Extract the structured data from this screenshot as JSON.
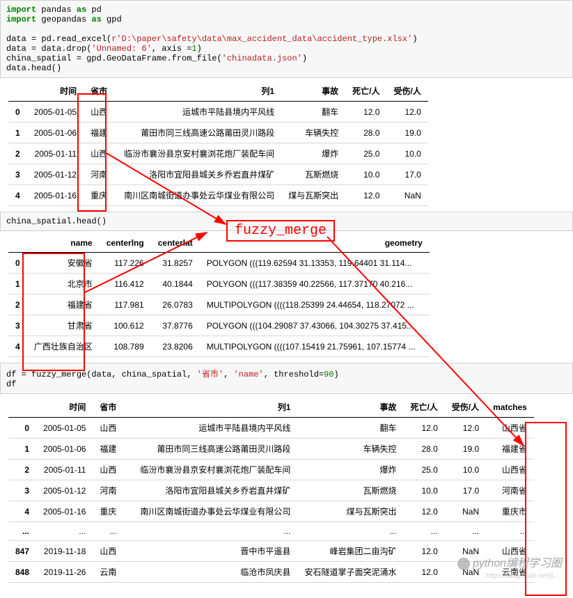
{
  "code1": {
    "l1a": "import",
    "l1b": " pandas ",
    "l1c": "as",
    "l1d": " pd",
    "l2a": "import",
    "l2b": " geopandas ",
    "l2c": "as",
    "l2d": " gpd",
    "l3": "",
    "l4a": "data = pd.read_excel(",
    "l4b": "r'D:\\paper\\safety\\data\\max_accident_data\\accident_type.xlsx'",
    "l4c": ")",
    "l5a": "data = data.drop(",
    "l5b": "'Unnamed: 6'",
    "l5c": ", axis =",
    "l5d": "1",
    "l5e": ")",
    "l6a": "china_spatial = gpd.GeoDataFrame.from_file(",
    "l6b": "'chinadata.json'",
    "l6c": ")",
    "l7": "data.head()"
  },
  "table1": {
    "headers": [
      "",
      "时间",
      "省市",
      "列1",
      "事故",
      "死亡/人",
      "受伤/人"
    ],
    "rows": [
      [
        "0",
        "2005-01-05",
        "山西",
        "运城市平陆县境内平风线",
        "翻车",
        "12.0",
        "12.0"
      ],
      [
        "1",
        "2005-01-06",
        "福建",
        "莆田市同三线高速公路莆田灵川路段",
        "车辆失控",
        "28.0",
        "19.0"
      ],
      [
        "2",
        "2005-01-11",
        "山西",
        "临汾市襄汾县京安村襄浏花炮厂装配车间",
        "爆炸",
        "25.0",
        "10.0"
      ],
      [
        "3",
        "2005-01-12",
        "河南",
        "洛阳市宜阳县城关乡乔岩直井煤矿",
        "瓦斯燃烧",
        "10.0",
        "17.0"
      ],
      [
        "4",
        "2005-01-16",
        "重庆",
        "南川区南城街道办事处云华煤业有限公司",
        "煤与瓦斯突出",
        "12.0",
        "NaN"
      ]
    ]
  },
  "code2": "china_spatial.head()",
  "table2": {
    "headers": [
      "",
      "name",
      "centerlng",
      "centerlat",
      "geometry"
    ],
    "rows": [
      [
        "0",
        "安徽省",
        "117.226",
        "31.8257",
        "POLYGON (((119.62594 31.13353, 119.64401 31.114..."
      ],
      [
        "1",
        "北京市",
        "116.412",
        "40.1844",
        "POLYGON (((117.38359 40.22566, 117.37170 40.216..."
      ],
      [
        "2",
        "福建省",
        "117.981",
        "26.0783",
        "MULTIPOLYGON ((((118.25399 24.44654, 118.27072 ..."
      ],
      [
        "3",
        "甘肃省",
        "100.612",
        "37.8776",
        "POLYGON (((104.29087 37.43066, 104.30275 37.415..."
      ],
      [
        "4",
        "广西壮族自治区",
        "108.789",
        "23.8206",
        "MULTIPOLYGON ((((107.15419 21.75961, 107.15774 ..."
      ]
    ]
  },
  "code3": {
    "l1a": "df = fuzzy_merge(data, china_spatial, ",
    "l1b": "'省市'",
    "l1c": ", ",
    "l1d": "'name'",
    "l1e": ", threshold=",
    "l1f": "90",
    "l1g": ")",
    "l2": "df"
  },
  "table3": {
    "headers": [
      "",
      "时间",
      "省市",
      "列1",
      "事故",
      "死亡/人",
      "受伤/人",
      "matches"
    ],
    "rows": [
      [
        "0",
        "2005-01-05",
        "山西",
        "运城市平陆县境内平风线",
        "翻车",
        "12.0",
        "12.0",
        "山西省"
      ],
      [
        "1",
        "2005-01-06",
        "福建",
        "莆田市同三线高速公路莆田灵川路段",
        "车辆失控",
        "28.0",
        "19.0",
        "福建省"
      ],
      [
        "2",
        "2005-01-11",
        "山西",
        "临汾市襄汾县京安村襄浏花炮厂装配车间",
        "爆炸",
        "25.0",
        "10.0",
        "山西省"
      ],
      [
        "3",
        "2005-01-12",
        "河南",
        "洛阳市宜阳县城关乡乔岩直井煤矿",
        "瓦斯燃烧",
        "10.0",
        "17.0",
        "河南省"
      ],
      [
        "4",
        "2005-01-16",
        "重庆",
        "南川区南城街道办事处云华煤业有限公司",
        "煤与瓦斯突出",
        "12.0",
        "NaN",
        "重庆市"
      ],
      [
        "...",
        "...",
        "...",
        "...",
        "...",
        "...",
        "...",
        "..."
      ],
      [
        "847",
        "2019-11-18",
        "山西",
        "晋中市平遥县",
        "峰岩集团二亩沟矿",
        "12.0",
        "NaN",
        "山西省"
      ],
      [
        "848",
        "2019-11-26",
        "云南",
        "临沧市凤庆县",
        "安石隧道掌子面突泥涌水",
        "12.0",
        "NaN",
        "云南省"
      ]
    ]
  },
  "fuzzy_label": "fuzzy_merge",
  "watermark": "python编程学习圈",
  "watermark_sub": "https://blog.csdn.net/ji..."
}
